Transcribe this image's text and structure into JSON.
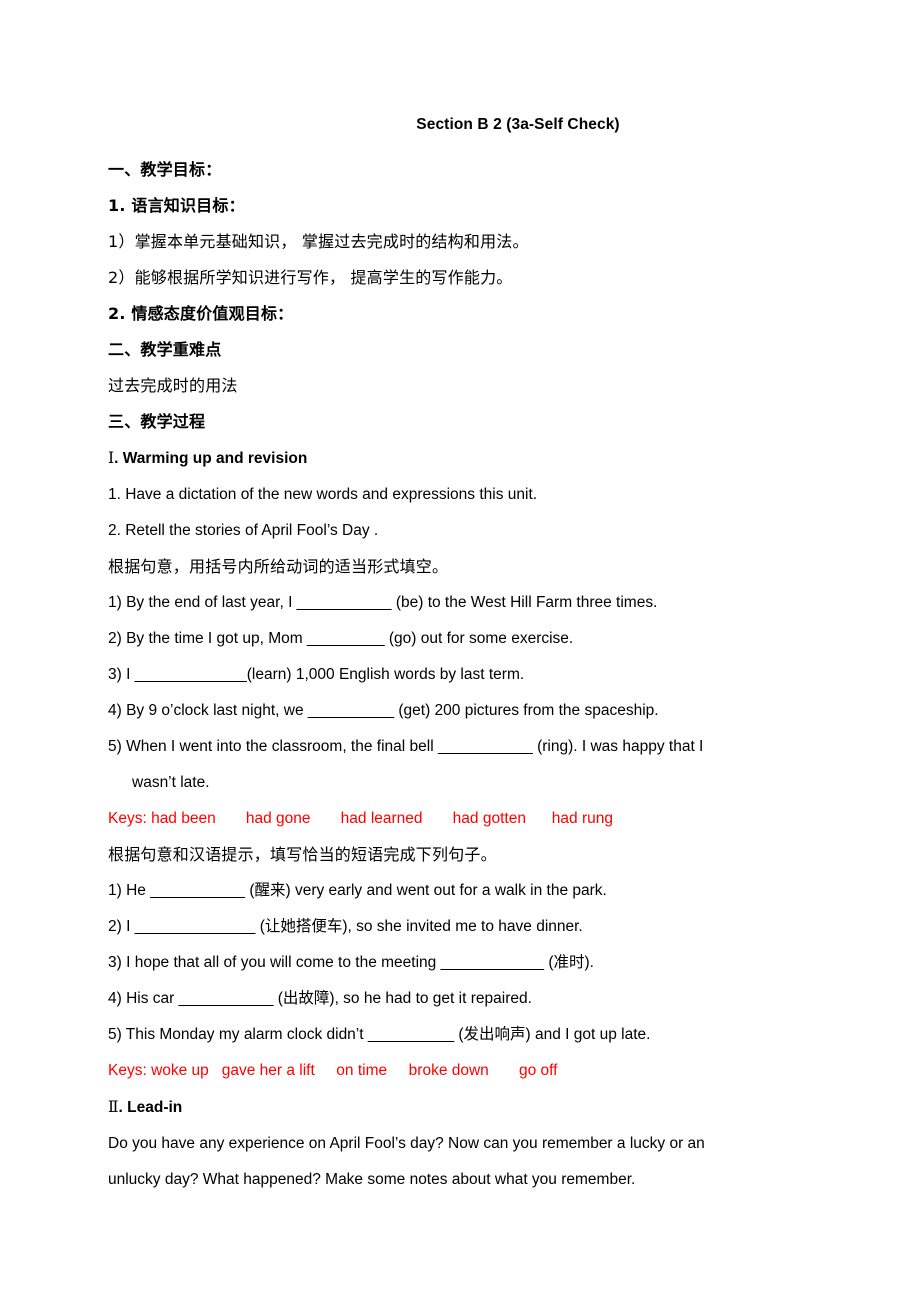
{
  "document": {
    "title": "Section B 2 (3a-Self Check)",
    "objectives_heading": "一、教学目标：",
    "lang_knowledge_heading": "1. 语言知识目标：",
    "lang_item_1": "1）掌握本单元基础知识， 掌握过去完成时的结构和用法。",
    "lang_item_2": "2）能够根据所学知识进行写作， 提高学生的写作能力。",
    "affective_heading": "2. 情感态度价值观目标：",
    "key_points_heading": "二、教学重难点",
    "key_points_body": "过去完成时的用法",
    "process_heading": "三、教学过程",
    "section_1_heading_numeral": "Ⅰ",
    "section_1_heading_text": ". Warming up and revision",
    "warmup_item_1": "1. Have a dictation of the new words and expressions this unit.",
    "warmup_item_2": "2. Retell the stories of April Fool’s Day .",
    "exercise_1_instruction": "根据句意，用括号内所给动词的适当形式填空。",
    "exercise_1_items": [
      "1) By the end of last year, I ___________ (be) to the West Hill Farm three times.",
      "2) By the time I got up, Mom _________ (go) out for some exercise.",
      "3) I _____________(learn) 1,000 English words by last term.",
      "4) By 9 o’clock last night, we __________ (get) 200 pictures from the spaceship.",
      "5) When I went into the classroom, the final bell ___________ (ring). I was happy that I"
    ],
    "exercise_1_item_5_continuation": "wasn’t late.",
    "keys_1_label": "Keys: had been",
    "keys_1_answers": [
      "had gone",
      "had learned",
      "had gotten",
      "had rung"
    ],
    "keys_1_full": "Keys: had been       had gone       had learned       had gotten      had rung",
    "exercise_2_instruction": "根据句意和汉语提示，填写恰当的短语完成下列句子。",
    "exercise_2_items": [
      "1) He ___________ (醒来) very early and went out for a walk in the park.",
      "2) I ______________ (让她搭便车), so she invited me to have dinner.",
      "3) I hope that all of you will come to the meeting ____________ (准时).",
      "4) His car ___________ (出故障), so he had to get it repaired.",
      "5) This Monday my alarm clock didn’t __________ (发出响声) and I got up late."
    ],
    "keys_2_label": "Keys: woke up",
    "keys_2_answers": [
      "gave her a lift",
      "on time",
      "broke down",
      "go off"
    ],
    "keys_2_full": "Keys: woke up   gave her a lift     on time     broke down       go off",
    "section_2_heading_numeral": "Ⅱ",
    "section_2_heading_text": ". Lead-in",
    "lead_in_paragraph_line_1": "Do you have any experience on April Fool’s day? Now can you remember a lucky or an",
    "lead_in_paragraph_line_2": "unlucky day? What happened? Make some notes about what you remember."
  },
  "colors": {
    "text": "#000000",
    "answer_key": "#ff0000",
    "background": "#ffffff"
  }
}
